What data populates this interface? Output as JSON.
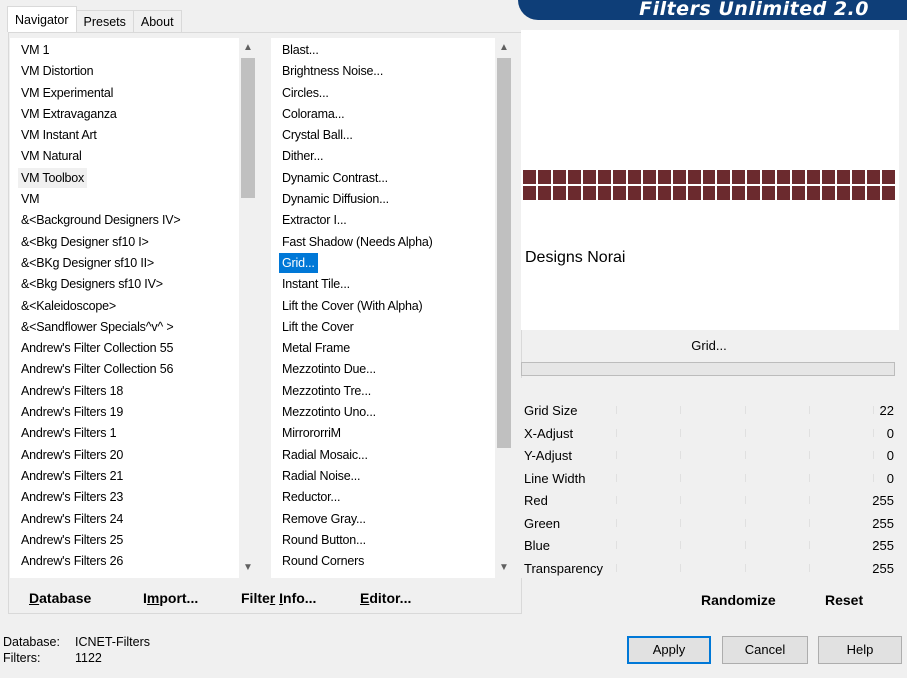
{
  "tabs": [
    "Navigator",
    "Presets",
    "About"
  ],
  "banner_title": "Filters Unlimited 2.0",
  "categories": [
    "VM 1",
    "VM Distortion",
    "VM Experimental",
    "VM Extravaganza",
    "VM Instant Art",
    "VM Natural",
    "VM Toolbox",
    "VM",
    "&<Background Designers IV>",
    "&<Bkg Designer sf10 I>",
    "&<BKg Designer sf10 II>",
    "&<Bkg Designers sf10 IV>",
    "&<Kaleidoscope>",
    "&<Sandflower Specials^v^ >",
    "Andrew's Filter Collection 55",
    "Andrew's Filter Collection 56",
    "Andrew's Filters 18",
    "Andrew's Filters 19",
    "Andrew's Filters 1",
    "Andrew's Filters 20",
    "Andrew's Filters 21",
    "Andrew's Filters 23",
    "Andrew's Filters 24",
    "Andrew's Filters 25",
    "Andrew's Filters 26"
  ],
  "filters": [
    "Blast...",
    "Brightness Noise...",
    "Circles...",
    "Colorama...",
    "Crystal Ball...",
    "Dither...",
    "Dynamic Contrast...",
    "Dynamic Diffusion...",
    "Extractor I...",
    "Fast Shadow (Needs Alpha)",
    "Grid...",
    "Instant Tile...",
    "Lift the Cover (With Alpha)",
    "Lift the Cover",
    "Metal Frame",
    "Mezzotinto Due...",
    "Mezzotinto Tre...",
    "Mezzotinto Uno...",
    "MirrororriM",
    "Radial Mosaic...",
    "Radial Noise...",
    "Reductor...",
    "Remove Gray...",
    "Round Button...",
    "Round Corners"
  ],
  "selected_category": "VM Toolbox",
  "selected_filter": "Grid...",
  "bottom_links": {
    "database": "Database",
    "import": "Import...",
    "filter_info": "Filter Info...",
    "editor": "Editor..."
  },
  "preview": {
    "designer": "Designs Norai",
    "color": "#6b2a2e"
  },
  "filter_title": "Grid...",
  "params": [
    {
      "name": "Grid Size",
      "value": "22"
    },
    {
      "name": "X-Adjust",
      "value": "0"
    },
    {
      "name": "Y-Adjust",
      "value": "0"
    },
    {
      "name": "Line Width",
      "value": "0"
    },
    {
      "name": "Red",
      "value": "255"
    },
    {
      "name": "Green",
      "value": "255"
    },
    {
      "name": "Blue",
      "value": "255"
    },
    {
      "name": "Transparency",
      "value": "255"
    }
  ],
  "right_links": {
    "randomize": "Randomize",
    "reset": "Reset"
  },
  "status": {
    "database_label": "Database:",
    "database_value": "ICNET-Filters",
    "filters_label": "Filters:",
    "filters_value": "1122"
  },
  "buttons": {
    "apply": "Apply",
    "cancel": "Cancel",
    "help": "Help"
  }
}
